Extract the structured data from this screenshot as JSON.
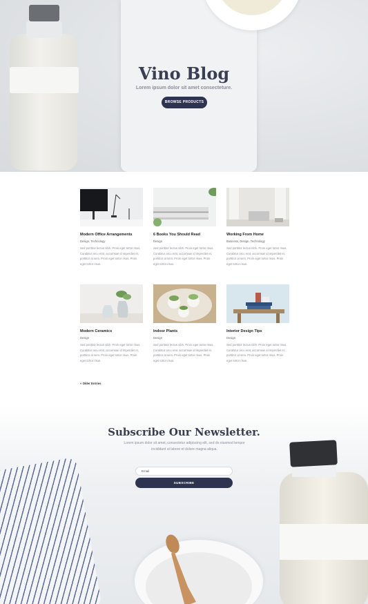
{
  "hero": {
    "title": "Vino Blog",
    "subtitle": "Lorem ipsum dolor sit amet consecteture.",
    "button_label": "BROWSE PRODUCTS"
  },
  "posts": [
    {
      "title": "Modern Office Arrangements",
      "categories": "Design, Technology",
      "excerpt": "Sed porttitor lectus nibh. Proin eget tortor risus. Curabitur arcu erat, accumsan id imperdiet et, porttitor at sem. Proin eget tortor risus. Proin eget tortor risus."
    },
    {
      "title": "6 Books You Should Read",
      "categories": "Design",
      "excerpt": "Sed porttitor lectus nibh. Proin eget tortor risus. Curabitur arcu erat, accumsan id imperdiet et, porttitor at sem. Proin eget tortor risus. Proin eget tortor risus."
    },
    {
      "title": "Working From Home",
      "categories": "Business, Design, Technology",
      "excerpt": "Sed porttitor lectus nibh. Proin eget tortor risus. Curabitur arcu erat, accumsan id imperdiet et, porttitor at sem. Proin eget tortor risus. Proin eget tortor risus."
    },
    {
      "title": "Modern Ceramics",
      "categories": "Design",
      "excerpt": "Sed porttitor lectus nibh. Proin eget tortor risus. Curabitur arcu erat, accumsan id imperdiet et, porttitor at sem. Proin eget tortor risus. Proin eget tortor risus."
    },
    {
      "title": "Indoor Plants",
      "categories": "Design",
      "excerpt": "Sed porttitor lectus nibh. Proin eget tortor risus. Curabitur arcu erat, accumsan id imperdiet et, porttitor at sem. Proin eget tortor risus. Proin eget tortor risus."
    },
    {
      "title": "Interior Design Tips",
      "categories": "Design",
      "excerpt": "Sed porttitor lectus nibh. Proin eget tortor risus. Curabitur arcu erat, accumsan id imperdiet et, porttitor at sem. Proin eget tortor risus. Proin eget tortor risus."
    }
  ],
  "pagination": {
    "older_label": "« Older Entries"
  },
  "newsletter": {
    "title": "Subscribe Our Newsletter.",
    "description": "Lorem ipsum dolor sit amet, consectetur adipiscing elit, sed do eiusmod tempor incididunt ut labore et dolore magna aliqua.",
    "email_placeholder": "Email",
    "button_label": "SUBSCRIBE"
  },
  "colors": {
    "accent": "#2e3350",
    "hero_bg": "#dfe2e5"
  }
}
